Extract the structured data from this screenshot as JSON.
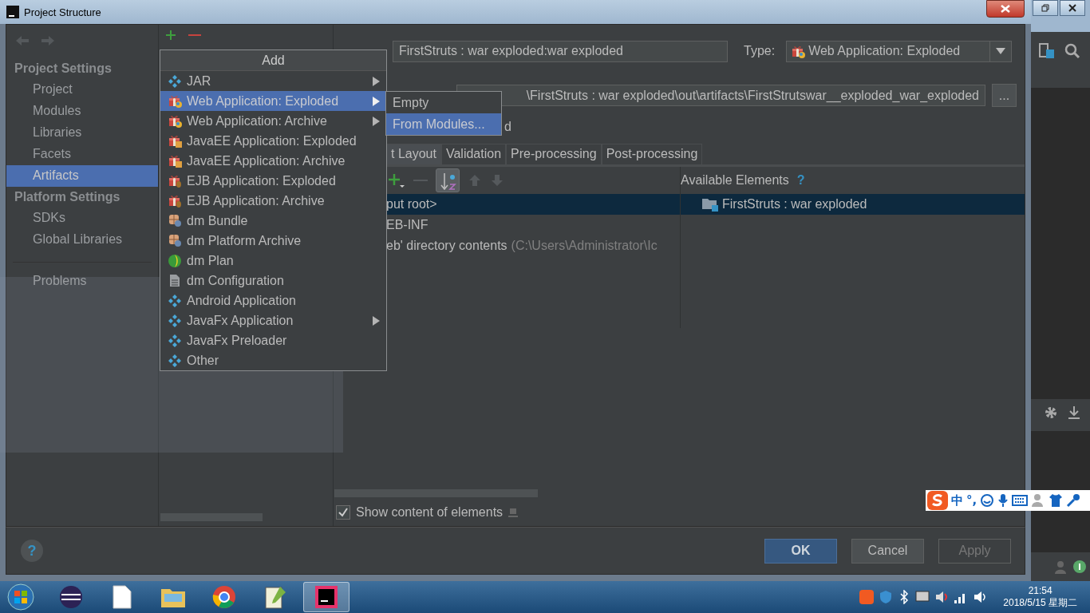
{
  "window": {
    "title": "Project Structure"
  },
  "sidebar": {
    "sections": [
      {
        "heading": "Project Settings",
        "items": [
          {
            "label": "Project",
            "selected": false
          },
          {
            "label": "Modules",
            "selected": false
          },
          {
            "label": "Libraries",
            "selected": false
          },
          {
            "label": "Facets",
            "selected": false
          },
          {
            "label": "Artifacts",
            "selected": true
          }
        ]
      },
      {
        "heading": "Platform Settings",
        "items": [
          {
            "label": "SDKs",
            "selected": false
          },
          {
            "label": "Global Libraries",
            "selected": false
          }
        ]
      }
    ],
    "problems": "Problems"
  },
  "add_menu": {
    "title": "Add",
    "items": [
      {
        "label": "JAR",
        "kind": "diamond",
        "submenu": true,
        "selected": false
      },
      {
        "label": "Web Application: Exploded",
        "kind": "web",
        "submenu": true,
        "selected": true
      },
      {
        "label": "Web Application: Archive",
        "kind": "web",
        "submenu": true,
        "selected": false
      },
      {
        "label": "JavaEE Application: Exploded",
        "kind": "javaee",
        "submenu": false,
        "selected": false
      },
      {
        "label": "JavaEE Application: Archive",
        "kind": "javaee",
        "submenu": false,
        "selected": false
      },
      {
        "label": "EJB Application: Exploded",
        "kind": "ejb",
        "submenu": false,
        "selected": false
      },
      {
        "label": "EJB Application: Archive",
        "kind": "ejb",
        "submenu": false,
        "selected": false
      },
      {
        "label": "dm Bundle",
        "kind": "bundle",
        "submenu": false,
        "selected": false
      },
      {
        "label": "dm Platform Archive",
        "kind": "bundle",
        "submenu": false,
        "selected": false
      },
      {
        "label": "dm Plan",
        "kind": "plan",
        "submenu": false,
        "selected": false
      },
      {
        "label": "dm Configuration",
        "kind": "config",
        "submenu": false,
        "selected": false
      },
      {
        "label": "Android Application",
        "kind": "diamond",
        "submenu": false,
        "selected": false
      },
      {
        "label": "JavaFx Application",
        "kind": "diamond",
        "submenu": true,
        "selected": false
      },
      {
        "label": "JavaFx Preloader",
        "kind": "diamond",
        "submenu": false,
        "selected": false
      },
      {
        "label": "Other",
        "kind": "diamond",
        "submenu": false,
        "selected": false
      }
    ]
  },
  "submenu": {
    "items": [
      {
        "label": "Empty",
        "selected": false
      },
      {
        "label": "From Modules...",
        "selected": true
      }
    ]
  },
  "artifact": {
    "name": "FirstStruts : war  exploded:war exploded",
    "type_label": "Type:",
    "type": "Web Application: Exploded",
    "output_dir": "\\FirstStruts : war  exploded\\out\\artifacts\\FirstStrutswar__exploded_war_exploded",
    "browse": "...",
    "build_fragment": "d"
  },
  "tabs": [
    {
      "label": "t Layout",
      "selected": true
    },
    {
      "label": "Validation",
      "selected": false
    },
    {
      "label": "Pre-processing",
      "selected": false
    },
    {
      "label": "Post-processing",
      "selected": false
    }
  ],
  "sort_button": {
    "selected": true
  },
  "layout_tree": [
    {
      "label": "put root>",
      "selected": true
    },
    {
      "label": "EB-INF",
      "selected": false
    },
    {
      "label": "eb' directory contents",
      "hint": "(C:\\Users\\Administrator\\Ic",
      "selected": false
    }
  ],
  "available": {
    "heading": "Available Elements",
    "help": "?",
    "items": [
      {
        "label": "FirstStruts : war  exploded",
        "selected": true
      }
    ]
  },
  "show_content": {
    "label": "Show content of elements",
    "checked": true
  },
  "buttons": [
    {
      "label": "OK",
      "default": true,
      "disabled": false
    },
    {
      "label": "Cancel",
      "default": false,
      "disabled": false
    },
    {
      "label": "Apply",
      "default": false,
      "disabled": true
    }
  ],
  "help_button": "?",
  "ime_bar": {
    "mode": "中",
    "punct": "°,"
  },
  "taskbar": {
    "apps": [
      {
        "kind": "eclipse",
        "active": false
      },
      {
        "kind": "file",
        "active": false
      },
      {
        "kind": "folder",
        "active": false
      },
      {
        "kind": "chrome",
        "active": false
      },
      {
        "kind": "notepad",
        "active": false
      },
      {
        "kind": "intellij",
        "active": true
      }
    ],
    "time": "21:54",
    "date": "2018/5/15 星期二"
  }
}
